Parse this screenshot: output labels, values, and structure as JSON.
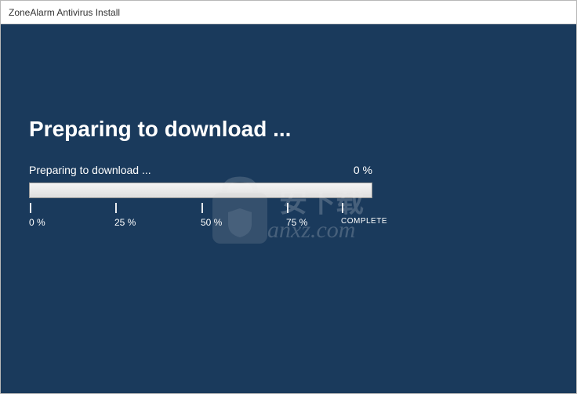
{
  "window": {
    "title": "ZoneAlarm Antivirus Install"
  },
  "installer": {
    "heading": "Preparing to download ...",
    "status_text": "Preparing to download ...",
    "percent_text": "0 %",
    "progress_value": 0,
    "ticks": {
      "t0": "0 %",
      "t25": "25 %",
      "t50": "50 %",
      "t75": "75 %",
      "complete": "COMPLETE"
    }
  },
  "watermark": {
    "cn": "安下载",
    "url": "anxz.com"
  }
}
